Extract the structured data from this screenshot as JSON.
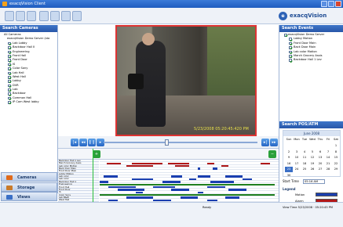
{
  "window": {
    "title": "exacqVision Client"
  },
  "toolbar": {
    "tools": [
      "live-icon",
      "search-icon",
      "config-icon",
      "layout1-icon",
      "layout4-icon",
      "layout9-icon",
      "layout16-icon"
    ]
  },
  "brand": {
    "logo_text": "exacqVision"
  },
  "left_panel": {
    "title": "Search Cameras",
    "tree": [
      {
        "label": "All Cameras",
        "level": "top",
        "checked": false
      },
      {
        "label": "exacqVision Demo Server (sta",
        "level": "server",
        "checked": true
      },
      {
        "label": "Lab Lobby",
        "checked": true
      },
      {
        "label": "Backdoor Hall II",
        "checked": true
      },
      {
        "label": "Engineering",
        "checked": true
      },
      {
        "label": "Front Hall",
        "checked": true
      },
      {
        "label": "Front Door",
        "checked": true
      },
      {
        "label": "IS",
        "checked": true
      },
      {
        "label": "Color Sony",
        "checked": true
      },
      {
        "label": "Lab Hall",
        "checked": true
      },
      {
        "label": "West Hall",
        "checked": true
      },
      {
        "label": "Lobby",
        "checked": true
      },
      {
        "label": "DVR",
        "checked": true
      },
      {
        "label": "Lab",
        "checked": true
      },
      {
        "label": "Backdoor",
        "checked": true
      },
      {
        "label": "Common Hall",
        "checked": true
      },
      {
        "label": "IP Cam West lobby",
        "checked": true
      }
    ],
    "nav": [
      {
        "label": "Cameras",
        "color": "#e06a1a"
      },
      {
        "label": "Storage",
        "color": "#c97a2a"
      },
      {
        "label": "Views",
        "color": "#3a6fc6"
      }
    ]
  },
  "video": {
    "timestamp": "5/23/2008 05:20:45:420 PM"
  },
  "right_panel": {
    "events_title": "Search Events",
    "events": [
      {
        "label": "exacqVision Demo Server",
        "checked": true
      },
      {
        "label": "Lobby Motion",
        "checked": true
      },
      {
        "label": "Front Door Main",
        "checked": true
      },
      {
        "label": "Back Door Main",
        "checked": true
      },
      {
        "label": "Lab color Motion",
        "checked": true
      },
      {
        "label": "March Grocery Assis",
        "checked": true
      },
      {
        "label": "Backdoor Hall 1 Lev",
        "checked": true
      }
    ],
    "pos_title": "Search POS/ATM",
    "calendar": {
      "month": "June 2008",
      "weekdays": [
        "Sun",
        "Mon",
        "Tue",
        "Wed",
        "Thu",
        "Fri",
        "Sat"
      ],
      "days": [
        "",
        "",
        "",
        "",
        "",
        "",
        "1",
        "2",
        "3",
        "4",
        "5",
        "6",
        "7",
        "8",
        "9",
        "10",
        "11",
        "12",
        "13",
        "14",
        "15",
        "16",
        "17",
        "18",
        "19",
        "20",
        "21",
        "22",
        "23",
        "24",
        "25",
        "26",
        "27",
        "28",
        "29",
        "30"
      ],
      "selected": "23"
    },
    "start_time_label": "Start Time",
    "start_time_value": "05:16 AM",
    "legend_title": "Legend",
    "legend": [
      {
        "label": "Motion",
        "color": "#1a3fb0"
      },
      {
        "label": "Alarm",
        "color": "#b01818"
      },
      {
        "label": "Free Run",
        "color": "#1f7f1f"
      },
      {
        "label": "None",
        "color": "#ffffff"
      }
    ]
  },
  "timeline": {
    "rows": [
      {
        "label": "Backdoor Hall 1 Lev",
        "segs": [],
        "color": "#b01818"
      },
      {
        "label": "March Grocery Assis",
        "segs": [
          [
            0.04,
            0.12
          ],
          [
            0.18,
            0.35
          ],
          [
            0.38,
            0.5
          ],
          [
            0.6,
            0.64
          ],
          [
            0.9,
            0.95
          ]
        ],
        "color": "#b01818"
      },
      {
        "label": "Lab color Motion",
        "segs": [
          [
            0.15,
            0.3
          ],
          [
            0.42,
            0.5
          ],
          [
            0.68,
            0.72
          ]
        ],
        "color": "#b01818"
      },
      {
        "label": "Back Door Main",
        "segs": [
          [
            0.55,
            0.56
          ],
          [
            0.63,
            0.66
          ]
        ],
        "color": "#1a3fb0"
      },
      {
        "label": "Front Door Main",
        "segs": [],
        "color": "#1a3fb0"
      },
      {
        "label": "Lobby Motion",
        "segs": [],
        "color": "#1a3fb0"
      },
      {
        "label": "Lab color",
        "segs": [
          [
            0.02,
            0.1
          ],
          [
            0.4,
            0.46
          ],
          [
            0.55,
            0.62
          ],
          [
            0.7,
            0.8
          ]
        ],
        "color": "#1a3fb0"
      },
      {
        "label": "Lab color",
        "segs": [
          [
            0.18,
            0.3
          ],
          [
            0.5,
            0.54
          ],
          [
            0.8,
            0.85
          ]
        ],
        "color": "#1a3fb0"
      },
      {
        "label": "Backdoor Hall 1",
        "segs": [
          [
            0.0,
            0.05
          ],
          [
            0.35,
            0.45
          ],
          [
            0.62,
            0.75
          ]
        ],
        "color": "#1a3fb0"
      },
      {
        "label": "Engineering",
        "segs": [
          [
            0.0,
            0.98
          ]
        ],
        "color": "#1f7f1f"
      },
      {
        "label": "Front Hall",
        "segs": [
          [
            0.05,
            0.2
          ],
          [
            0.3,
            0.42
          ],
          [
            0.6,
            0.7
          ]
        ],
        "color": "#1a3fb0"
      },
      {
        "label": "Front Door",
        "segs": [
          [
            0.1,
            0.25
          ],
          [
            0.4,
            0.5
          ],
          [
            0.72,
            0.82
          ]
        ],
        "color": "#1a3fb0"
      },
      {
        "label": "IS",
        "segs": [
          [
            0.2,
            0.24
          ],
          [
            0.55,
            0.58
          ]
        ],
        "color": "#1a3fb0"
      },
      {
        "label": "Color Sony",
        "segs": [
          [
            0.0,
            0.98
          ]
        ],
        "color": "#1f7f1f"
      },
      {
        "label": "Lab B&W",
        "segs": [
          [
            0.15,
            0.3
          ],
          [
            0.45,
            0.55
          ],
          [
            0.7,
            0.78
          ]
        ],
        "color": "#1a3fb0"
      },
      {
        "label": "West Hall",
        "segs": [
          [
            0.05,
            0.1
          ],
          [
            0.3,
            0.4
          ],
          [
            0.6,
            0.66
          ]
        ],
        "color": "#1a3fb0"
      }
    ]
  },
  "status": {
    "center": "Ready",
    "right": "View Time 5/23/2008 · 05:20:45 PM"
  }
}
